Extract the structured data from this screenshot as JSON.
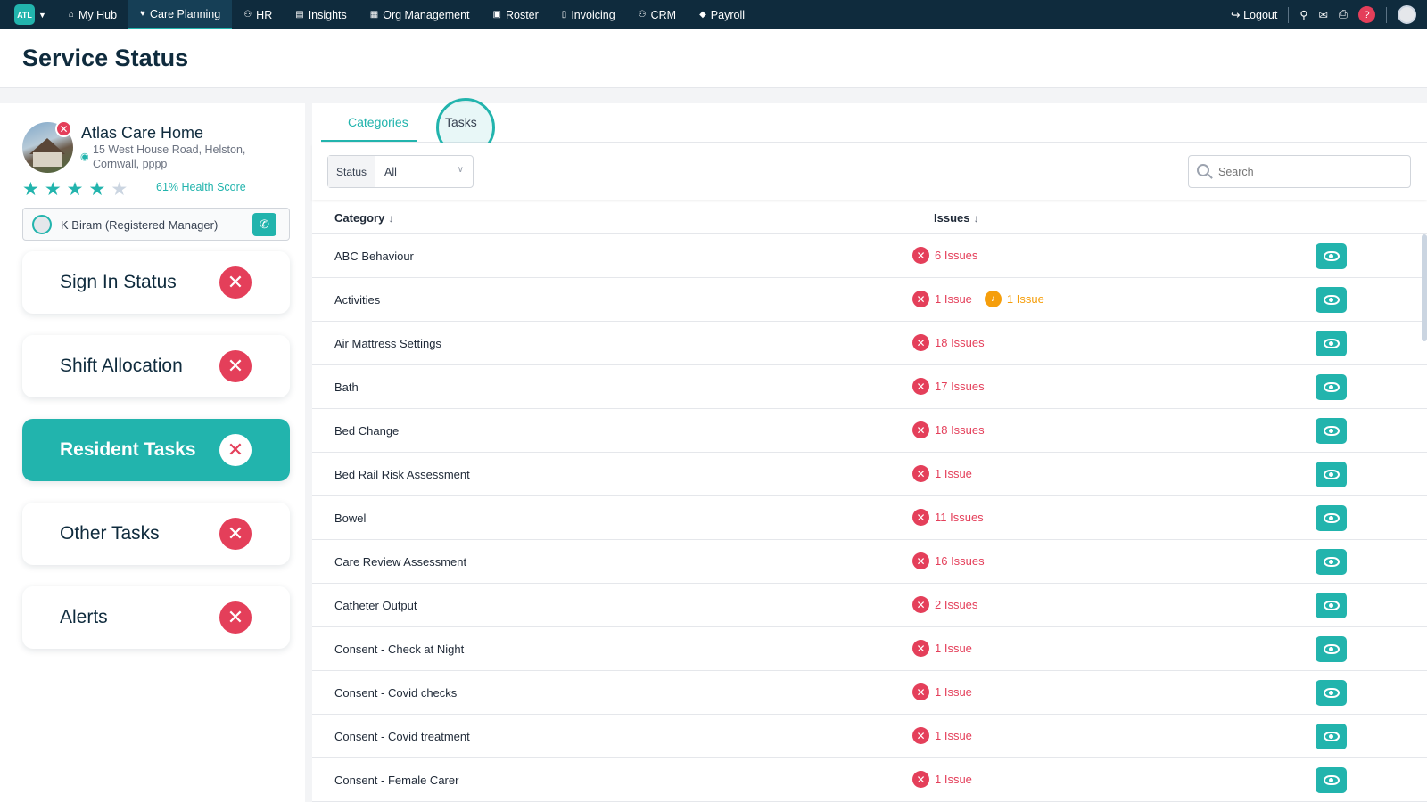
{
  "nav": {
    "logo_text": "ATL",
    "items": [
      {
        "label": "My Hub",
        "icon": "home-icon",
        "active": false
      },
      {
        "label": "Care Planning",
        "icon": "heart-icon",
        "active": true
      },
      {
        "label": "HR",
        "icon": "people-icon",
        "active": false
      },
      {
        "label": "Insights",
        "icon": "chart-icon",
        "active": false
      },
      {
        "label": "Org Management",
        "icon": "building-icon",
        "active": false
      },
      {
        "label": "Roster",
        "icon": "calendar-icon",
        "active": false
      },
      {
        "label": "Invoicing",
        "icon": "document-icon",
        "active": false
      },
      {
        "label": "CRM",
        "icon": "contacts-icon",
        "active": false
      },
      {
        "label": "Payroll",
        "icon": "tag-icon",
        "active": false
      }
    ],
    "logout_label": "Logout",
    "help_label": "?"
  },
  "page": {
    "title": "Service Status"
  },
  "home": {
    "name": "Atlas Care Home",
    "address": "15 West House Road, Helston, Cornwall, pppp",
    "rating": 4,
    "rating_max": 5,
    "health_score": "61% Health Score",
    "manager": "K Biram (Registered Manager)"
  },
  "status_cards": [
    {
      "label": "Sign In Status",
      "active": false
    },
    {
      "label": "Shift Allocation",
      "active": false
    },
    {
      "label": "Resident Tasks",
      "active": true
    },
    {
      "label": "Other Tasks",
      "active": false
    },
    {
      "label": "Alerts",
      "active": false
    }
  ],
  "tabs": {
    "categories": "Categories",
    "tasks": "Tasks"
  },
  "filters": {
    "status_label": "Status",
    "status_value": "All",
    "search_placeholder": "Search"
  },
  "table": {
    "headers": {
      "category": "Category",
      "issues": "Issues"
    },
    "rows": [
      {
        "category": "ABC Behaviour",
        "issues": [
          {
            "text": "6 Issues",
            "level": "red"
          }
        ]
      },
      {
        "category": "Activities",
        "issues": [
          {
            "text": "1 Issue",
            "level": "red"
          },
          {
            "text": "1 Issue",
            "level": "orange"
          }
        ]
      },
      {
        "category": "Air Mattress Settings",
        "issues": [
          {
            "text": "18 Issues",
            "level": "red"
          }
        ]
      },
      {
        "category": "Bath",
        "issues": [
          {
            "text": "17 Issues",
            "level": "red"
          }
        ]
      },
      {
        "category": "Bed Change",
        "issues": [
          {
            "text": "18 Issues",
            "level": "red"
          }
        ]
      },
      {
        "category": "Bed Rail Risk Assessment",
        "issues": [
          {
            "text": "1 Issue",
            "level": "red"
          }
        ]
      },
      {
        "category": "Bowel",
        "issues": [
          {
            "text": "11 Issues",
            "level": "red"
          }
        ]
      },
      {
        "category": "Care Review Assessment",
        "issues": [
          {
            "text": "16 Issues",
            "level": "red"
          }
        ]
      },
      {
        "category": "Catheter Output",
        "issues": [
          {
            "text": "2 Issues",
            "level": "red"
          }
        ]
      },
      {
        "category": "Consent - Check at Night",
        "issues": [
          {
            "text": "1 Issue",
            "level": "red"
          }
        ]
      },
      {
        "category": "Consent - Covid checks",
        "issues": [
          {
            "text": "1 Issue",
            "level": "red"
          }
        ]
      },
      {
        "category": "Consent - Covid treatment",
        "issues": [
          {
            "text": "1 Issue",
            "level": "red"
          }
        ]
      },
      {
        "category": "Consent - Female Carer",
        "issues": [
          {
            "text": "1 Issue",
            "level": "red"
          }
        ]
      }
    ]
  },
  "colors": {
    "brand": "#22b4ad",
    "nav_bg": "#0f2b3d",
    "error": "#e43f5a",
    "warning": "#f59e0b"
  }
}
